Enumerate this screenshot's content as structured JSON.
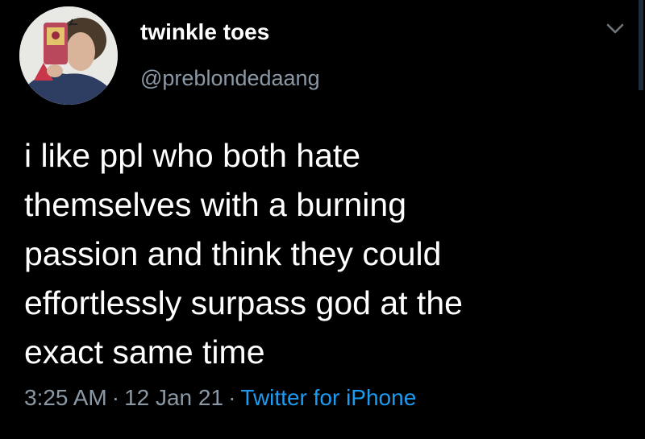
{
  "author": {
    "display_name": "twinkle toes",
    "handle": "@preblondedaang"
  },
  "tweet": {
    "lines": [
      "i like ppl who both hate",
      "themselves with a burning",
      "passion and think they could",
      "effortlessly surpass god at the",
      "exact same time"
    ]
  },
  "meta": {
    "time": "3:25 AM",
    "separator": "·",
    "date": "12 Jan 21",
    "source": "Twitter for iPhone"
  },
  "colors": {
    "background": "#000000",
    "text": "#ffffff",
    "secondary_text": "#8b98a5",
    "link": "#1d9bf0"
  },
  "icons": {
    "menu": "chevron-down-icon"
  }
}
